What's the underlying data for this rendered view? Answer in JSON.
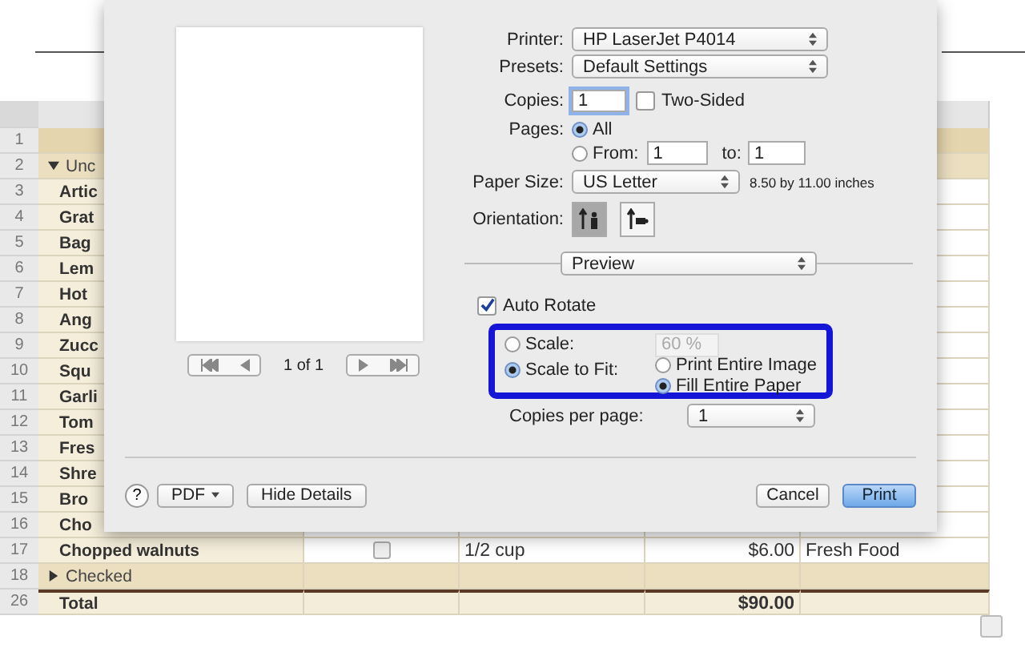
{
  "spreadsheet": {
    "rows": [
      {
        "number": "1",
        "kind": "header"
      },
      {
        "number": "2",
        "kind": "group",
        "label": "Unc",
        "expanded": true
      },
      {
        "number": "3",
        "kind": "item",
        "name": "Artic"
      },
      {
        "number": "4",
        "kind": "item",
        "name": "Grat"
      },
      {
        "number": "5",
        "kind": "item",
        "name": "Bag"
      },
      {
        "number": "6",
        "kind": "item",
        "name": "Lem"
      },
      {
        "number": "7",
        "kind": "item",
        "name": "Hot"
      },
      {
        "number": "8",
        "kind": "item",
        "name": "Ang"
      },
      {
        "number": "9",
        "kind": "item",
        "name": "Zucc"
      },
      {
        "number": "10",
        "kind": "item",
        "name": "Squ"
      },
      {
        "number": "11",
        "kind": "item",
        "name": "Garli"
      },
      {
        "number": "12",
        "kind": "item",
        "name": "Tom"
      },
      {
        "number": "13",
        "kind": "item",
        "name": "Fres"
      },
      {
        "number": "14",
        "kind": "item",
        "name": "Shre"
      },
      {
        "number": "15",
        "kind": "item",
        "name": "Bro"
      },
      {
        "number": "16",
        "kind": "item",
        "name": "Cho"
      },
      {
        "number": "17",
        "kind": "item",
        "name": "Chopped walnuts",
        "checked": false,
        "amount": "1/2 cup",
        "price": "$6.00",
        "category": "Fresh Food"
      },
      {
        "number": "18",
        "kind": "group",
        "label": "Checked",
        "expanded": false
      },
      {
        "number": "26",
        "kind": "total",
        "label": "Total",
        "price": "$90.00"
      }
    ]
  },
  "print_dialog": {
    "preview": {
      "page_indicator": "1 of 1"
    },
    "printer": {
      "label": "Printer:",
      "value": "HP LaserJet P4014"
    },
    "presets": {
      "label": "Presets:",
      "value": "Default Settings"
    },
    "copies": {
      "label": "Copies:",
      "value": "1"
    },
    "two_sided": {
      "label": "Two-Sided",
      "checked": false
    },
    "pages": {
      "label": "Pages:",
      "options": [
        {
          "label": "All",
          "selected": true
        },
        {
          "label": "From:",
          "selected": false
        }
      ],
      "from": "1",
      "to_label": "to:",
      "to": "1"
    },
    "paper_size": {
      "label": "Paper Size:",
      "value": "US Letter",
      "dimensions": "8.50 by 11.00 inches"
    },
    "orientation": {
      "label": "Orientation:",
      "options": [
        {
          "kind": "portrait",
          "selected": true
        },
        {
          "kind": "landscape",
          "selected": false
        }
      ]
    },
    "section": "Preview",
    "auto_rotate": {
      "label": "Auto Rotate",
      "checked": true
    },
    "scale": {
      "options": [
        {
          "label": "Scale:",
          "selected": false
        },
        {
          "label": "Scale to Fit:",
          "selected": true
        }
      ],
      "value": "60 %",
      "fit_options": [
        {
          "label": "Print Entire Image",
          "selected": false
        },
        {
          "label": "Fill Entire Paper",
          "selected": true
        }
      ]
    },
    "copies_per_page": {
      "label": "Copies per page:",
      "value": "1"
    },
    "buttons": [
      {
        "kind": "help",
        "label": "?"
      },
      {
        "kind": "menu",
        "label": "PDF"
      },
      {
        "kind": "plain",
        "label": "Hide Details"
      },
      {
        "kind": "plain",
        "label": "Cancel"
      },
      {
        "kind": "default",
        "label": "Print"
      }
    ]
  }
}
